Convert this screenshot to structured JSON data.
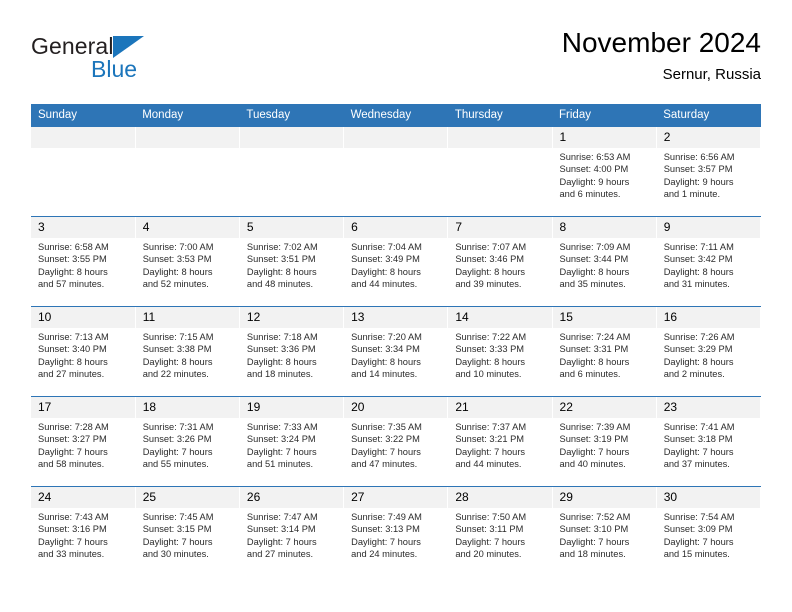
{
  "brand": {
    "name_part1": "General",
    "name_part2": "Blue",
    "accent_color": "#1b75bb"
  },
  "header": {
    "title": "November 2024",
    "subtitle": "Sernur, Russia",
    "header_bg_color": "#2e75b6"
  },
  "weekday_headers": [
    "Sunday",
    "Monday",
    "Tuesday",
    "Wednesday",
    "Thursday",
    "Friday",
    "Saturday"
  ],
  "labels": {
    "sunrise": "Sunrise:",
    "sunset": "Sunset:",
    "daylight": "Daylight:"
  },
  "weeks": [
    [
      {
        "empty": true
      },
      {
        "empty": true
      },
      {
        "empty": true
      },
      {
        "empty": true
      },
      {
        "empty": true
      },
      {
        "day": "1",
        "sunrise": "Sunrise: 6:53 AM",
        "sunset": "Sunset: 4:00 PM",
        "daylight_1": "Daylight: 9 hours",
        "daylight_2": "and 6 minutes."
      },
      {
        "day": "2",
        "sunrise": "Sunrise: 6:56 AM",
        "sunset": "Sunset: 3:57 PM",
        "daylight_1": "Daylight: 9 hours",
        "daylight_2": "and 1 minute."
      }
    ],
    [
      {
        "day": "3",
        "sunrise": "Sunrise: 6:58 AM",
        "sunset": "Sunset: 3:55 PM",
        "daylight_1": "Daylight: 8 hours",
        "daylight_2": "and 57 minutes."
      },
      {
        "day": "4",
        "sunrise": "Sunrise: 7:00 AM",
        "sunset": "Sunset: 3:53 PM",
        "daylight_1": "Daylight: 8 hours",
        "daylight_2": "and 52 minutes."
      },
      {
        "day": "5",
        "sunrise": "Sunrise: 7:02 AM",
        "sunset": "Sunset: 3:51 PM",
        "daylight_1": "Daylight: 8 hours",
        "daylight_2": "and 48 minutes."
      },
      {
        "day": "6",
        "sunrise": "Sunrise: 7:04 AM",
        "sunset": "Sunset: 3:49 PM",
        "daylight_1": "Daylight: 8 hours",
        "daylight_2": "and 44 minutes."
      },
      {
        "day": "7",
        "sunrise": "Sunrise: 7:07 AM",
        "sunset": "Sunset: 3:46 PM",
        "daylight_1": "Daylight: 8 hours",
        "daylight_2": "and 39 minutes."
      },
      {
        "day": "8",
        "sunrise": "Sunrise: 7:09 AM",
        "sunset": "Sunset: 3:44 PM",
        "daylight_1": "Daylight: 8 hours",
        "daylight_2": "and 35 minutes."
      },
      {
        "day": "9",
        "sunrise": "Sunrise: 7:11 AM",
        "sunset": "Sunset: 3:42 PM",
        "daylight_1": "Daylight: 8 hours",
        "daylight_2": "and 31 minutes."
      }
    ],
    [
      {
        "day": "10",
        "sunrise": "Sunrise: 7:13 AM",
        "sunset": "Sunset: 3:40 PM",
        "daylight_1": "Daylight: 8 hours",
        "daylight_2": "and 27 minutes."
      },
      {
        "day": "11",
        "sunrise": "Sunrise: 7:15 AM",
        "sunset": "Sunset: 3:38 PM",
        "daylight_1": "Daylight: 8 hours",
        "daylight_2": "and 22 minutes."
      },
      {
        "day": "12",
        "sunrise": "Sunrise: 7:18 AM",
        "sunset": "Sunset: 3:36 PM",
        "daylight_1": "Daylight: 8 hours",
        "daylight_2": "and 18 minutes."
      },
      {
        "day": "13",
        "sunrise": "Sunrise: 7:20 AM",
        "sunset": "Sunset: 3:34 PM",
        "daylight_1": "Daylight: 8 hours",
        "daylight_2": "and 14 minutes."
      },
      {
        "day": "14",
        "sunrise": "Sunrise: 7:22 AM",
        "sunset": "Sunset: 3:33 PM",
        "daylight_1": "Daylight: 8 hours",
        "daylight_2": "and 10 minutes."
      },
      {
        "day": "15",
        "sunrise": "Sunrise: 7:24 AM",
        "sunset": "Sunset: 3:31 PM",
        "daylight_1": "Daylight: 8 hours",
        "daylight_2": "and 6 minutes."
      },
      {
        "day": "16",
        "sunrise": "Sunrise: 7:26 AM",
        "sunset": "Sunset: 3:29 PM",
        "daylight_1": "Daylight: 8 hours",
        "daylight_2": "and 2 minutes."
      }
    ],
    [
      {
        "day": "17",
        "sunrise": "Sunrise: 7:28 AM",
        "sunset": "Sunset: 3:27 PM",
        "daylight_1": "Daylight: 7 hours",
        "daylight_2": "and 58 minutes."
      },
      {
        "day": "18",
        "sunrise": "Sunrise: 7:31 AM",
        "sunset": "Sunset: 3:26 PM",
        "daylight_1": "Daylight: 7 hours",
        "daylight_2": "and 55 minutes."
      },
      {
        "day": "19",
        "sunrise": "Sunrise: 7:33 AM",
        "sunset": "Sunset: 3:24 PM",
        "daylight_1": "Daylight: 7 hours",
        "daylight_2": "and 51 minutes."
      },
      {
        "day": "20",
        "sunrise": "Sunrise: 7:35 AM",
        "sunset": "Sunset: 3:22 PM",
        "daylight_1": "Daylight: 7 hours",
        "daylight_2": "and 47 minutes."
      },
      {
        "day": "21",
        "sunrise": "Sunrise: 7:37 AM",
        "sunset": "Sunset: 3:21 PM",
        "daylight_1": "Daylight: 7 hours",
        "daylight_2": "and 44 minutes."
      },
      {
        "day": "22",
        "sunrise": "Sunrise: 7:39 AM",
        "sunset": "Sunset: 3:19 PM",
        "daylight_1": "Daylight: 7 hours",
        "daylight_2": "and 40 minutes."
      },
      {
        "day": "23",
        "sunrise": "Sunrise: 7:41 AM",
        "sunset": "Sunset: 3:18 PM",
        "daylight_1": "Daylight: 7 hours",
        "daylight_2": "and 37 minutes."
      }
    ],
    [
      {
        "day": "24",
        "sunrise": "Sunrise: 7:43 AM",
        "sunset": "Sunset: 3:16 PM",
        "daylight_1": "Daylight: 7 hours",
        "daylight_2": "and 33 minutes."
      },
      {
        "day": "25",
        "sunrise": "Sunrise: 7:45 AM",
        "sunset": "Sunset: 3:15 PM",
        "daylight_1": "Daylight: 7 hours",
        "daylight_2": "and 30 minutes."
      },
      {
        "day": "26",
        "sunrise": "Sunrise: 7:47 AM",
        "sunset": "Sunset: 3:14 PM",
        "daylight_1": "Daylight: 7 hours",
        "daylight_2": "and 27 minutes."
      },
      {
        "day": "27",
        "sunrise": "Sunrise: 7:49 AM",
        "sunset": "Sunset: 3:13 PM",
        "daylight_1": "Daylight: 7 hours",
        "daylight_2": "and 24 minutes."
      },
      {
        "day": "28",
        "sunrise": "Sunrise: 7:50 AM",
        "sunset": "Sunset: 3:11 PM",
        "daylight_1": "Daylight: 7 hours",
        "daylight_2": "and 20 minutes."
      },
      {
        "day": "29",
        "sunrise": "Sunrise: 7:52 AM",
        "sunset": "Sunset: 3:10 PM",
        "daylight_1": "Daylight: 7 hours",
        "daylight_2": "and 18 minutes."
      },
      {
        "day": "30",
        "sunrise": "Sunrise: 7:54 AM",
        "sunset": "Sunset: 3:09 PM",
        "daylight_1": "Daylight: 7 hours",
        "daylight_2": "and 15 minutes."
      }
    ]
  ]
}
